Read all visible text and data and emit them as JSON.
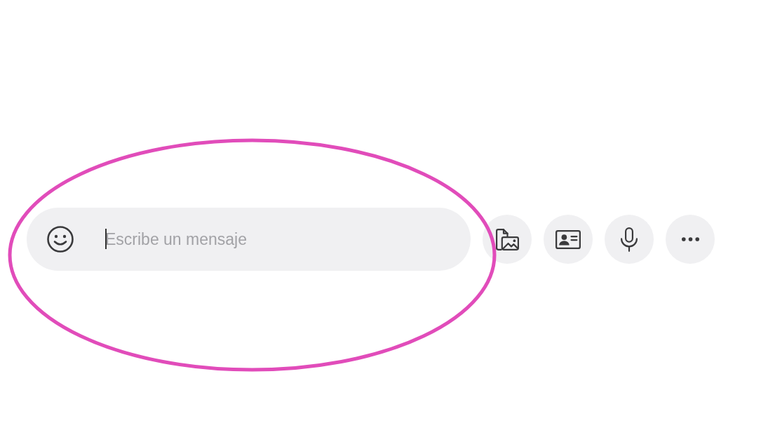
{
  "message_input": {
    "placeholder": "Escribe un mensaje",
    "focused": true
  },
  "actions": [
    {
      "kind": "attach"
    },
    {
      "kind": "contact"
    },
    {
      "kind": "voice"
    },
    {
      "kind": "more"
    }
  ],
  "annotation": {
    "kind": "ellipse"
  }
}
